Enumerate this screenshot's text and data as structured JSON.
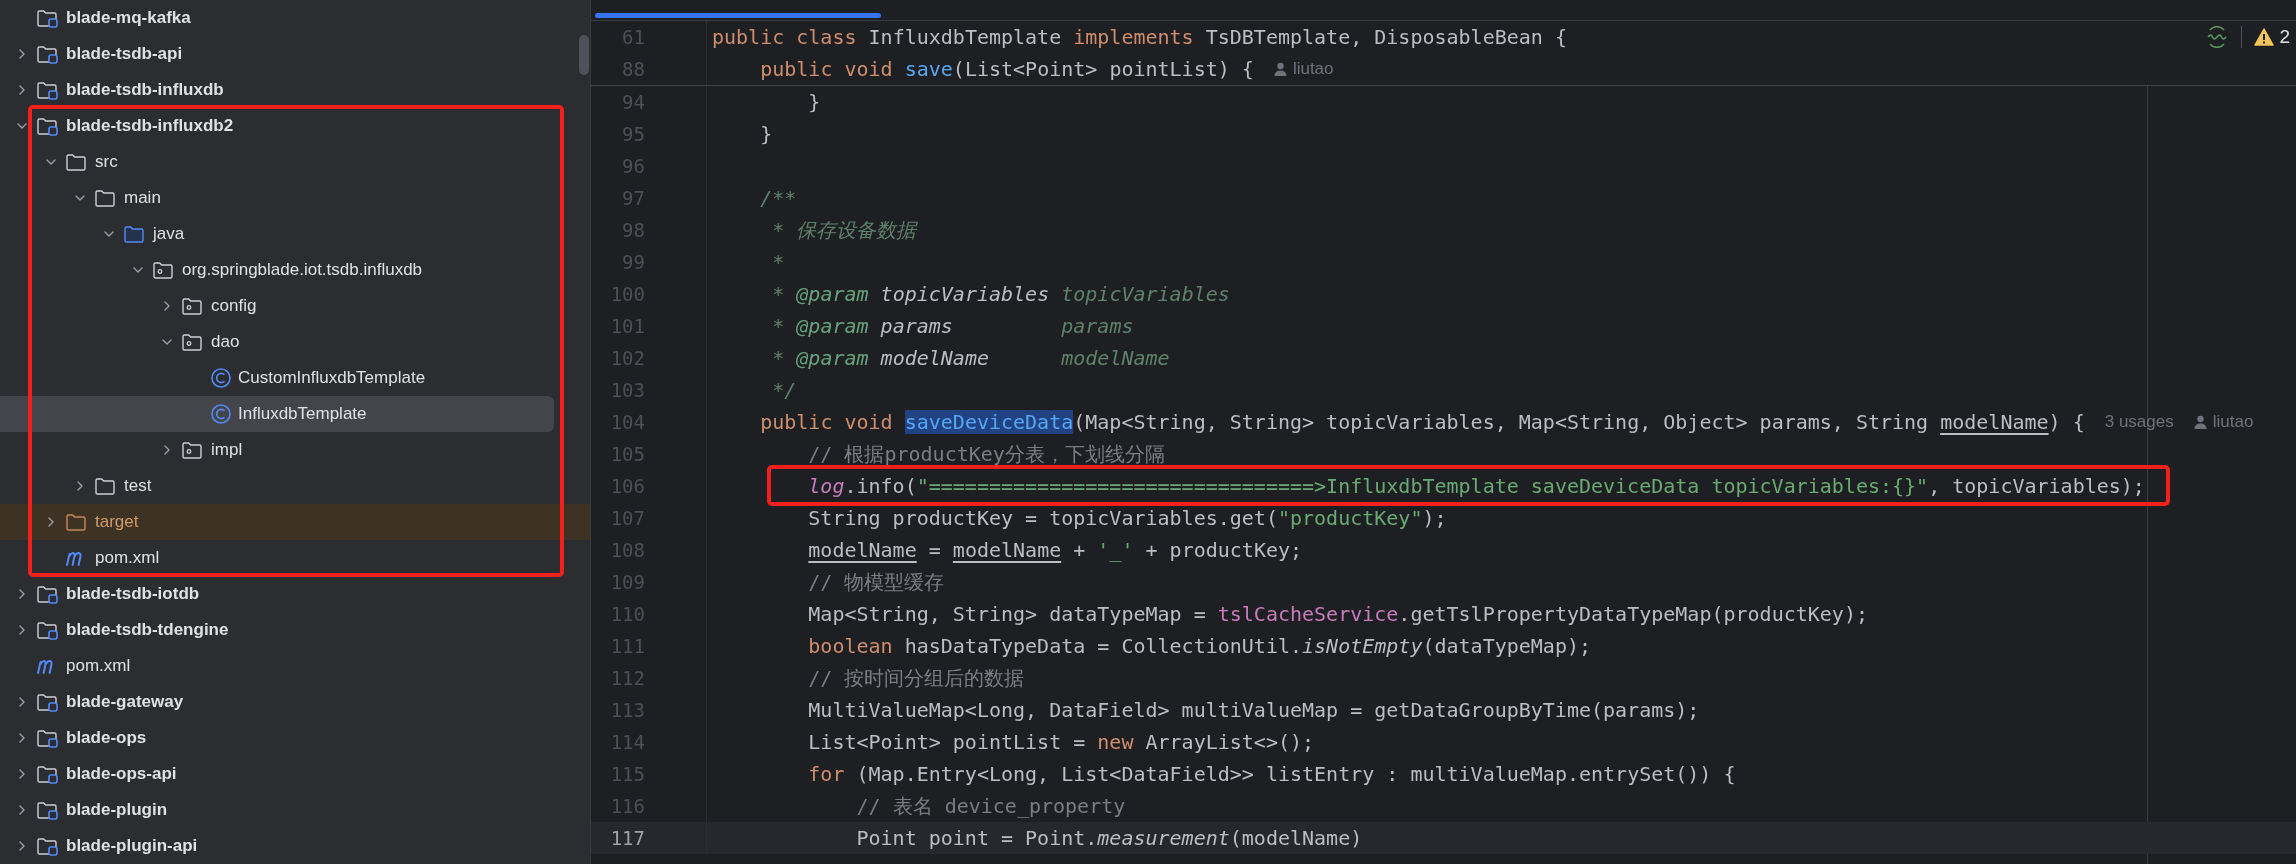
{
  "project_tree": [
    {
      "children": [
        {
          "label": "blade-mq-kafka",
          "kind": "module",
          "selected": false,
          "highlighted": false
        },
        {
          "label": "blade-tsdb-api",
          "kind": "module",
          "expanded": false,
          "selected": false,
          "highlighted": false
        },
        {
          "label": "blade-tsdb-influxdb",
          "kind": "module",
          "expanded": false,
          "selected": false,
          "highlighted": false
        },
        {
          "label": "blade-tsdb-influxdb2",
          "kind": "module",
          "expanded": true,
          "selected": false,
          "highlighted": true,
          "children": [
            {
              "label": "src",
              "kind": "folder",
              "expanded": true,
              "selected": false,
              "children": [
                {
                  "label": "main",
                  "kind": "folder",
                  "expanded": true,
                  "selected": false,
                  "children": [
                    {
                      "label": "java",
                      "kind": "source-root",
                      "expanded": true,
                      "selected": false,
                      "children": [
                        {
                          "label": "org.springblade.iot.tsdb.influxdb",
                          "kind": "package",
                          "expanded": true,
                          "selected": false,
                          "children": [
                            {
                              "label": "config",
                              "kind": "package",
                              "expanded": false,
                              "selected": false
                            },
                            {
                              "label": "dao",
                              "kind": "package",
                              "expanded": true,
                              "selected": false,
                              "children": [
                                {
                                  "label": "CustomInfluxdbTemplate",
                                  "kind": "class",
                                  "selected": false
                                },
                                {
                                  "label": "InfluxdbTemplate",
                                  "kind": "class",
                                  "selected": true
                                }
                              ]
                            },
                            {
                              "label": "impl",
                              "kind": "package",
                              "expanded": false,
                              "selected": false
                            }
                          ]
                        }
                      ]
                    }
                  ]
                },
                {
                  "label": "test",
                  "kind": "folder",
                  "expanded": false,
                  "selected": false
                }
              ]
            },
            {
              "label": "target",
              "kind": "excluded",
              "expanded": false,
              "selected": false
            },
            {
              "label": "pom.xml",
              "kind": "maven",
              "selected": false
            }
          ]
        },
        {
          "label": "blade-tsdb-iotdb",
          "kind": "module",
          "expanded": false,
          "selected": false,
          "highlighted": false
        },
        {
          "label": "blade-tsdb-tdengine",
          "kind": "module",
          "expanded": false,
          "selected": false,
          "highlighted": false
        },
        {
          "label": "pom.xml",
          "kind": "maven",
          "selected": false
        }
      ]
    },
    {
      "label": "blade-gateway",
      "kind": "module",
      "expanded": false,
      "selected": false,
      "highlighted": false
    },
    {
      "label": "blade-ops",
      "kind": "module",
      "expanded": false,
      "selected": false,
      "highlighted": false
    },
    {
      "label": "blade-ops-api",
      "kind": "module",
      "expanded": false,
      "selected": false,
      "highlighted": false
    },
    {
      "label": "blade-plugin",
      "kind": "module",
      "expanded": false,
      "selected": false,
      "highlighted": false
    },
    {
      "label": "blade-plugin-api",
      "kind": "module",
      "expanded": false,
      "selected": false,
      "highlighted": false
    }
  ],
  "editor": {
    "inspections": {
      "warnings": "2"
    },
    "sticky_lines": [
      {
        "number": "61",
        "tokens": [
          {
            "kind": "keyword",
            "text": "public class "
          },
          {
            "kind": "plain",
            "text": "InfluxdbTemplate "
          },
          {
            "kind": "keyword",
            "text": "implements "
          },
          {
            "kind": "plain",
            "text": "TsDBTemplate, DisposableBean {"
          }
        ]
      },
      {
        "number": "88",
        "tokens": [
          {
            "kind": "keyword",
            "text": "    public void "
          },
          {
            "kind": "declaration",
            "text": "save"
          },
          {
            "kind": "plain",
            "text": "(List<Point> pointList) {"
          },
          {
            "kind": "author",
            "text": "liutao"
          }
        ]
      }
    ],
    "lines": [
      {
        "number": "94",
        "current": false,
        "highlighted": false,
        "tokens": [
          {
            "kind": "plain",
            "text": "        }"
          }
        ]
      },
      {
        "number": "95",
        "current": false,
        "highlighted": false,
        "tokens": [
          {
            "kind": "plain",
            "text": "    }"
          }
        ]
      },
      {
        "number": "96",
        "current": false,
        "highlighted": false
      },
      {
        "number": "97",
        "current": false,
        "highlighted": false,
        "tokens": [
          {
            "kind": "doc",
            "text": "    /**"
          }
        ]
      },
      {
        "number": "98",
        "current": false,
        "highlighted": false,
        "tokens": [
          {
            "kind": "doc",
            "text": "     * 保存设备数据"
          }
        ]
      },
      {
        "number": "99",
        "current": false,
        "highlighted": false,
        "tokens": [
          {
            "kind": "doc",
            "text": "     *"
          }
        ]
      },
      {
        "number": "100",
        "current": false,
        "highlighted": false,
        "tokens": [
          {
            "kind": "doc",
            "text": "     * "
          },
          {
            "kind": "doc-tag",
            "text": "@param"
          },
          {
            "kind": "doc-param",
            "text": " topicVariables"
          },
          {
            "kind": "doc",
            "text": " topicVariables"
          }
        ]
      },
      {
        "number": "101",
        "current": false,
        "highlighted": false,
        "tokens": [
          {
            "kind": "doc",
            "text": "     * "
          },
          {
            "kind": "doc-tag",
            "text": "@param"
          },
          {
            "kind": "doc-param",
            "text": " params"
          },
          {
            "kind": "doc",
            "text": "         params"
          }
        ]
      },
      {
        "number": "102",
        "current": false,
        "highlighted": false,
        "tokens": [
          {
            "kind": "doc",
            "text": "     * "
          },
          {
            "kind": "doc-tag",
            "text": "@param"
          },
          {
            "kind": "doc-param",
            "text": " modelName"
          },
          {
            "kind": "doc",
            "text": "      modelName"
          }
        ]
      },
      {
        "number": "103",
        "current": false,
        "highlighted": false,
        "tokens": [
          {
            "kind": "doc",
            "text": "     */"
          }
        ]
      },
      {
        "number": "104",
        "current": false,
        "highlighted": false,
        "tokens": [
          {
            "kind": "keyword",
            "text": "    public void "
          },
          {
            "kind": "selected-declaration",
            "text": "saveDeviceData"
          },
          {
            "kind": "plain",
            "text": "(Map<String, String> topicVariables, Map<String, Object> params, String "
          },
          {
            "kind": "reassigned",
            "text": "modelName"
          },
          {
            "kind": "plain",
            "text": ") {"
          },
          {
            "kind": "hint",
            "text": "3 usages"
          },
          {
            "kind": "author",
            "text": "liutao"
          }
        ]
      },
      {
        "number": "105",
        "current": false,
        "highlighted": false,
        "tokens": [
          {
            "kind": "comment",
            "text": "        // 根据productKey分表，下划线分隔"
          }
        ]
      },
      {
        "number": "106",
        "current": false,
        "highlighted": true,
        "tokens": [
          {
            "kind": "static-field",
            "text": "        log"
          },
          {
            "kind": "plain",
            "text": ".info("
          },
          {
            "kind": "string",
            "text": "\"================================>InfluxdbTemplate saveDeviceData topicVariables:{}\""
          },
          {
            "kind": "plain",
            "text": ", topicVariables);"
          }
        ]
      },
      {
        "number": "107",
        "current": false,
        "highlighted": false,
        "tokens": [
          {
            "kind": "plain",
            "text": "        String productKey = topicVariables.get("
          },
          {
            "kind": "string",
            "text": "\"productKey\""
          },
          {
            "kind": "plain",
            "text": ");"
          }
        ]
      },
      {
        "number": "108",
        "current": false,
        "highlighted": false,
        "tokens": [
          {
            "kind": "reassigned",
            "text": "        modelName"
          },
          {
            "kind": "plain",
            "text": " = "
          },
          {
            "kind": "reassigned",
            "text": "modelName"
          },
          {
            "kind": "plain",
            "text": " + "
          },
          {
            "kind": "string",
            "text": "'_'"
          },
          {
            "kind": "plain",
            "text": " + productKey;"
          }
        ]
      },
      {
        "number": "109",
        "current": false,
        "highlighted": false,
        "tokens": [
          {
            "kind": "comment",
            "text": "        // 物模型缓存"
          }
        ]
      },
      {
        "number": "110",
        "current": false,
        "highlighted": false,
        "tokens": [
          {
            "kind": "plain",
            "text": "        Map<String, String> dataTypeMap = "
          },
          {
            "kind": "field",
            "text": "tslCacheService"
          },
          {
            "kind": "plain",
            "text": ".getTslPropertyDataTypeMap(productKey);"
          }
        ]
      },
      {
        "number": "111",
        "current": false,
        "highlighted": false,
        "tokens": [
          {
            "kind": "keyword",
            "text": "        boolean "
          },
          {
            "kind": "plain",
            "text": "hasDataTypeData = CollectionUtil."
          },
          {
            "kind": "static-call",
            "text": "isNotEmpty"
          },
          {
            "kind": "plain",
            "text": "(dataTypeMap);"
          }
        ]
      },
      {
        "number": "112",
        "current": false,
        "highlighted": false,
        "tokens": [
          {
            "kind": "comment",
            "text": "        // 按时间分组后的数据"
          }
        ]
      },
      {
        "number": "113",
        "current": false,
        "highlighted": false,
        "tokens": [
          {
            "kind": "plain",
            "text": "        MultiValueMap<Long, DataField> multiValueMap = getDataGroupByTime(params);"
          }
        ]
      },
      {
        "number": "114",
        "current": false,
        "highlighted": false,
        "tokens": [
          {
            "kind": "plain",
            "text": "        List<Point> pointList = "
          },
          {
            "kind": "keyword",
            "text": "new "
          },
          {
            "kind": "plain",
            "text": "ArrayList<>();"
          }
        ]
      },
      {
        "number": "115",
        "current": false,
        "highlighted": false,
        "tokens": [
          {
            "kind": "keyword",
            "text": "        for "
          },
          {
            "kind": "plain",
            "text": "(Map.Entry<Long, List<DataField>> listEntry : multiValueMap.entrySet()) {"
          }
        ]
      },
      {
        "number": "116",
        "current": false,
        "highlighted": false,
        "tokens": [
          {
            "kind": "comment",
            "text": "            // 表名 device_property"
          }
        ]
      },
      {
        "number": "117",
        "current": true,
        "highlighted": false,
        "tokens": [
          {
            "kind": "plain",
            "text": "            Point point = Point."
          },
          {
            "kind": "static-call",
            "text": "measurement"
          },
          {
            "kind": "plain",
            "text": "(modelName)"
          }
        ]
      }
    ]
  }
}
